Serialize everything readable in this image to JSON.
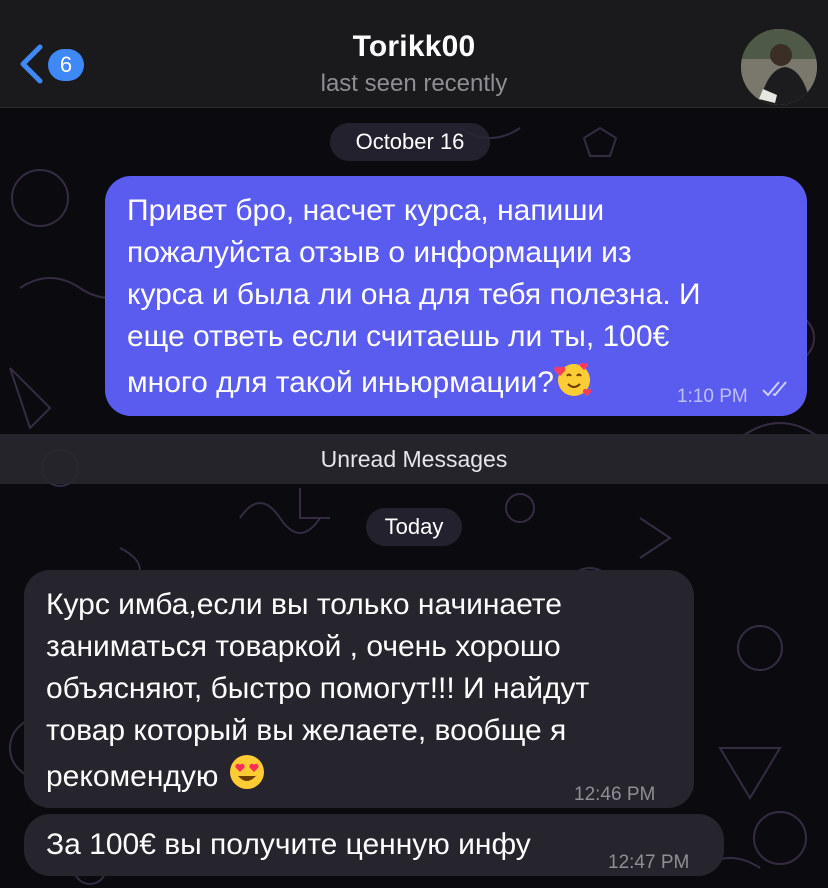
{
  "header": {
    "back_count": "6",
    "contact_name": "Torikk00",
    "status": "last seen recently"
  },
  "dates": {
    "first": "October 16",
    "second": "Today"
  },
  "unread_label": "Unread Messages",
  "messages": [
    {
      "direction": "outgoing",
      "lines": [
        "Привет бро, насчет курса, напиши",
        "пожалуйста отзыв о информации из",
        "курса и была ли она для тебя полезна. И",
        "еще ответь если считаешь ли ты, 100€",
        "много для такой иньюрмации?"
      ],
      "emoji": "smiling-face-with-hearts",
      "time": "1:10 PM",
      "read": true
    },
    {
      "direction": "incoming",
      "lines": [
        "Курс имба,если вы только начинаете",
        "заниматься товаркой , очень хорошо",
        "объясняют, быстро помогут!!! И найдут",
        "товар который вы желаете, вообще я",
        "рекомендую"
      ],
      "emoji": "heart-eyes",
      "time": "12:46 PM"
    },
    {
      "direction": "incoming",
      "lines": [
        "За 100€ вы получите ценную инфу"
      ],
      "time": "12:47 PM"
    }
  ],
  "colors": {
    "outgoing_bubble": "#5a5cf0",
    "incoming_bubble": "#26252d",
    "accent": "#3e88f7"
  }
}
